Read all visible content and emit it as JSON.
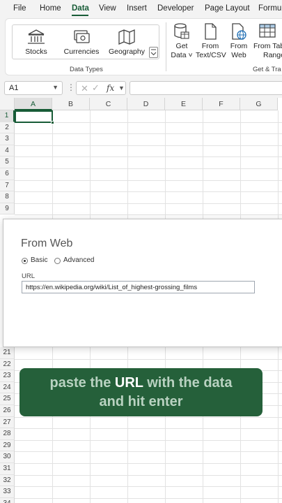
{
  "menu": {
    "tabs": [
      "File",
      "Home",
      "Data",
      "View",
      "Insert",
      "Developer",
      "Page Layout",
      "Formul"
    ],
    "active": "Data"
  },
  "ribbon": {
    "data_types": {
      "items": [
        "Stocks",
        "Currencies",
        "Geography"
      ],
      "group_label": "Data Types"
    },
    "get_transform": {
      "group_label": "Get & Tra",
      "get_data": {
        "line1": "Get",
        "line2": "Data ˅"
      },
      "from_text": {
        "line1": "From",
        "line2": "Text/CSV"
      },
      "from_web": {
        "line1": "From",
        "line2": "Web"
      },
      "from_table": {
        "line1": "From Tab",
        "line2": "Range"
      }
    }
  },
  "formula_bar": {
    "name_box": "A1",
    "dots": "⋮",
    "cancel": "✕",
    "enter": "✓",
    "fx": "fx"
  },
  "grid": {
    "columns": [
      "A",
      "B",
      "C",
      "D",
      "E",
      "F",
      "G"
    ],
    "rows_top": [
      "1",
      "2",
      "3",
      "4",
      "5",
      "6",
      "7",
      "8",
      "9"
    ],
    "rows_bottom": [
      "21",
      "22",
      "23",
      "24",
      "25",
      "26",
      "27",
      "28",
      "29",
      "30",
      "31",
      "32",
      "33",
      "34"
    ],
    "selected_cell": "A1"
  },
  "dialog": {
    "title": "From Web",
    "radio_basic": "Basic",
    "radio_advanced": "Advanced",
    "selected_mode": "Basic",
    "url_label": "URL",
    "url_value": "https://en.wikipedia.org/wiki/List_of_highest-grossing_films"
  },
  "caption": {
    "part1": "paste the ",
    "highlight": "URL",
    "part2": " with the data",
    "line2": "and hit enter"
  },
  "colors": {
    "accent": "#185c37",
    "banner": "#25603a"
  }
}
